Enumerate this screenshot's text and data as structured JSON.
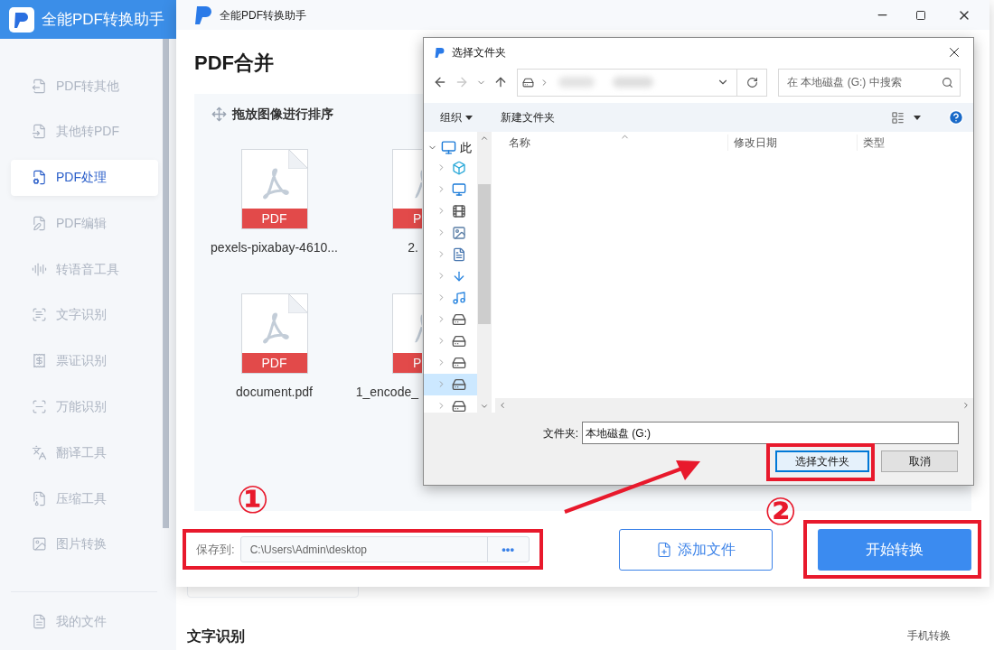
{
  "app": {
    "title": "全能PDF转换助手"
  },
  "sidebar": {
    "items": [
      {
        "label": "PDF转其他",
        "selected": false
      },
      {
        "label": "其他转PDF",
        "selected": false
      },
      {
        "label": "PDF处理",
        "selected": true
      },
      {
        "label": "PDF编辑",
        "selected": false
      },
      {
        "label": "转语音工具",
        "selected": false
      },
      {
        "label": "文字识别",
        "selected": false
      },
      {
        "label": "票证识别",
        "selected": false
      },
      {
        "label": "万能识别",
        "selected": false
      },
      {
        "label": "翻译工具",
        "selected": false
      },
      {
        "label": "压缩工具",
        "selected": false
      },
      {
        "label": "图片转换",
        "selected": false
      }
    ],
    "footer_item": "我的文件"
  },
  "background": {
    "section_title": "文字识别",
    "link": "手机转换"
  },
  "window": {
    "title": "全能PDF转换助手",
    "heading": "PDF合并",
    "drop_hint": "拖放图像进行排序",
    "files": [
      {
        "name": "pexels-pixabay-4610...",
        "badge": "PDF",
        "kind": "full"
      },
      {
        "name": "2.",
        "badge": "P",
        "kind": "clipped"
      },
      {
        "name": "document.pdf",
        "badge": "PDF",
        "kind": "full"
      },
      {
        "name": "1_encode_",
        "badge": "P",
        "kind": "clipped"
      }
    ],
    "save_label": "保存到:",
    "save_path": "C:\\Users\\Admin\\desktop",
    "browse_button": "•••",
    "add_button": "添加文件",
    "start_button": "开始转换"
  },
  "dialog": {
    "title": "选择文件夹",
    "search_placeholder": "在 本地磁盘 (G:) 中搜索",
    "toolbar": [
      "组织",
      "新建文件夹"
    ],
    "tree": [
      {
        "label": "此",
        "expanded": true,
        "selected": false,
        "children": [
          {
            "selected": false
          },
          {
            "selected": false
          },
          {
            "selected": false
          },
          {
            "selected": false
          },
          {
            "selected": false
          },
          {
            "selected": false
          },
          {
            "selected": false
          },
          {
            "selected": false
          },
          {
            "selected": false
          },
          {
            "selected": false
          },
          {
            "selected": true
          },
          {
            "selected": false
          }
        ]
      }
    ],
    "columns": [
      "名称",
      "修改日期",
      "类型"
    ],
    "folder_label": "文件夹:",
    "folder_value": "本地磁盘 (G:)",
    "buttons": [
      "选择文件夹",
      "取消"
    ]
  },
  "annotations": {
    "markers": [
      "①",
      "②"
    ]
  }
}
